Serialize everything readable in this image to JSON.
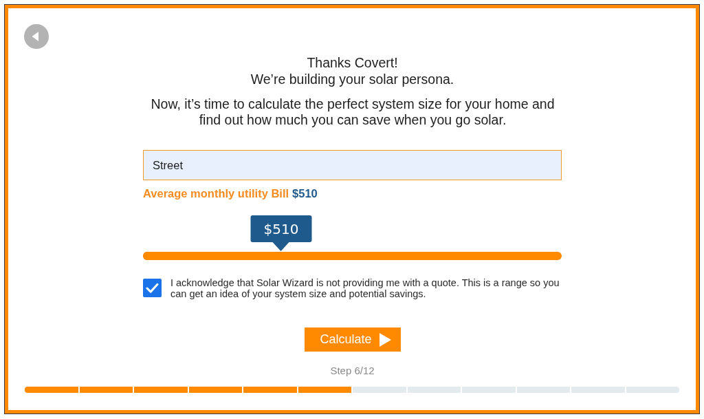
{
  "heading": {
    "title": "Thanks Covert!",
    "subtitle": "We’re building your solar persona."
  },
  "intro": "Now, it’s time to calculate the perfect system size for your home and find out how much you can save when you go solar.",
  "address_field": {
    "value": "Street"
  },
  "bill": {
    "label": "Average monthly utility Bill",
    "amount": "$510",
    "tooltip": "$510",
    "level": 0.33
  },
  "acknowledgement": {
    "checked": true,
    "text": "I acknowledge that Solar Wizard is not providing me with a quote. This is a range so you can get an idea of your system size and potential savings."
  },
  "calculate_button": {
    "label": "Calculate"
  },
  "progress": {
    "label": "Step 6/12",
    "steps": [
      {
        "completed": true
      },
      {
        "completed": true
      },
      {
        "completed": true
      },
      {
        "completed": true
      },
      {
        "completed": true
      },
      {
        "completed": true
      },
      {
        "completed": false
      },
      {
        "completed": false
      },
      {
        "completed": false
      },
      {
        "completed": false
      },
      {
        "completed": false
      },
      {
        "completed": false
      }
    ]
  }
}
